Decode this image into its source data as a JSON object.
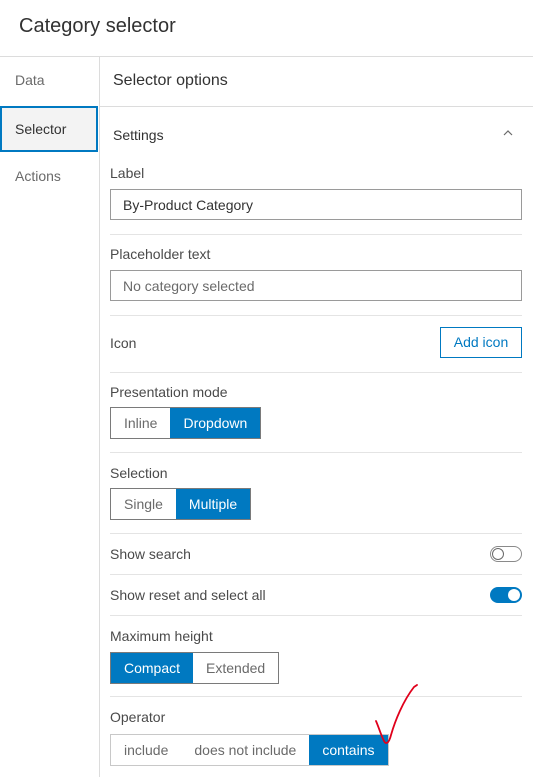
{
  "window": {
    "title": "Category selector"
  },
  "sidebar": {
    "items": [
      {
        "label": "Data",
        "active": false
      },
      {
        "label": "Selector",
        "active": true
      },
      {
        "label": "Actions",
        "active": false
      }
    ]
  },
  "main": {
    "header": "Selector options",
    "section": {
      "title": "Settings",
      "expanded": true,
      "chevron": "chevron-up-icon"
    },
    "label_field": {
      "label": "Label",
      "value": "By-Product Category"
    },
    "placeholder_field": {
      "label": "Placeholder text",
      "placeholder": "No category selected"
    },
    "icon": {
      "label": "Icon",
      "button": "Add icon"
    },
    "presentation_mode": {
      "label": "Presentation mode",
      "options": [
        "Inline",
        "Dropdown"
      ],
      "selected": "Dropdown"
    },
    "selection": {
      "label": "Selection",
      "options": [
        "Single",
        "Multiple"
      ],
      "selected": "Multiple"
    },
    "show_search": {
      "label": "Show search",
      "on": false
    },
    "show_reset": {
      "label": "Show reset and select all",
      "on": true
    },
    "max_height": {
      "label": "Maximum height",
      "options": [
        "Compact",
        "Extended"
      ],
      "selected": "Compact"
    },
    "operator": {
      "label": "Operator",
      "options": [
        "include",
        "does not include",
        "contains"
      ],
      "selected": "contains"
    }
  },
  "colors": {
    "accent": "#0079c1",
    "annotation": "#e0001b"
  }
}
